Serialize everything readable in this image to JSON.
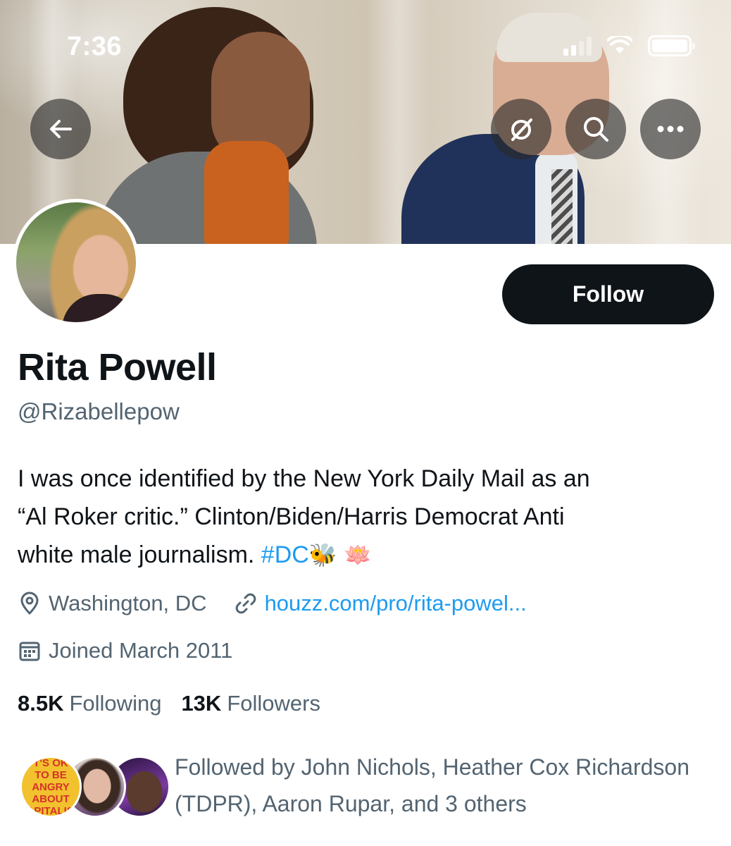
{
  "status_bar": {
    "time": "7:36"
  },
  "header": {
    "back_icon": "arrow-left-icon",
    "grok_icon": "slashed-circle-icon",
    "search_icon": "search-icon",
    "more_icon": "more-horizontal-icon"
  },
  "profile": {
    "follow_label": "Follow",
    "name": "Rita Powell",
    "handle": "@Rizabellepow",
    "bio": {
      "line1": "I was once identified by the New York Daily Mail as an",
      "line2": "“Al Roker critic.” Clinton/Biden/Harris Democrat Anti",
      "line3_text": "white male journalism. ",
      "hashtag": "#DC",
      "emoji_bee": "🐝",
      "emoji_lotus": "🪷"
    },
    "location": "Washington, DC",
    "website": "houzz.com/pro/rita-powel...",
    "joined": "Joined March 2011",
    "following_count": "8.5K",
    "following_label": "Following",
    "followers_count": "13K",
    "followers_label": "Followers"
  },
  "followed_by": {
    "text": "Followed by John Nichols, Heather Cox Richardson (TDPR), Aaron Rupar, and 3 others",
    "avatar1_lines": [
      "T'S OK",
      "TO BE",
      "ANGRY",
      "ABOUT",
      "CAPITALISM"
    ]
  },
  "colors": {
    "accent": "#1d9bf0",
    "secondary_text": "#536471",
    "primary_text": "#0f1419",
    "follow_button": "#0f1419"
  }
}
